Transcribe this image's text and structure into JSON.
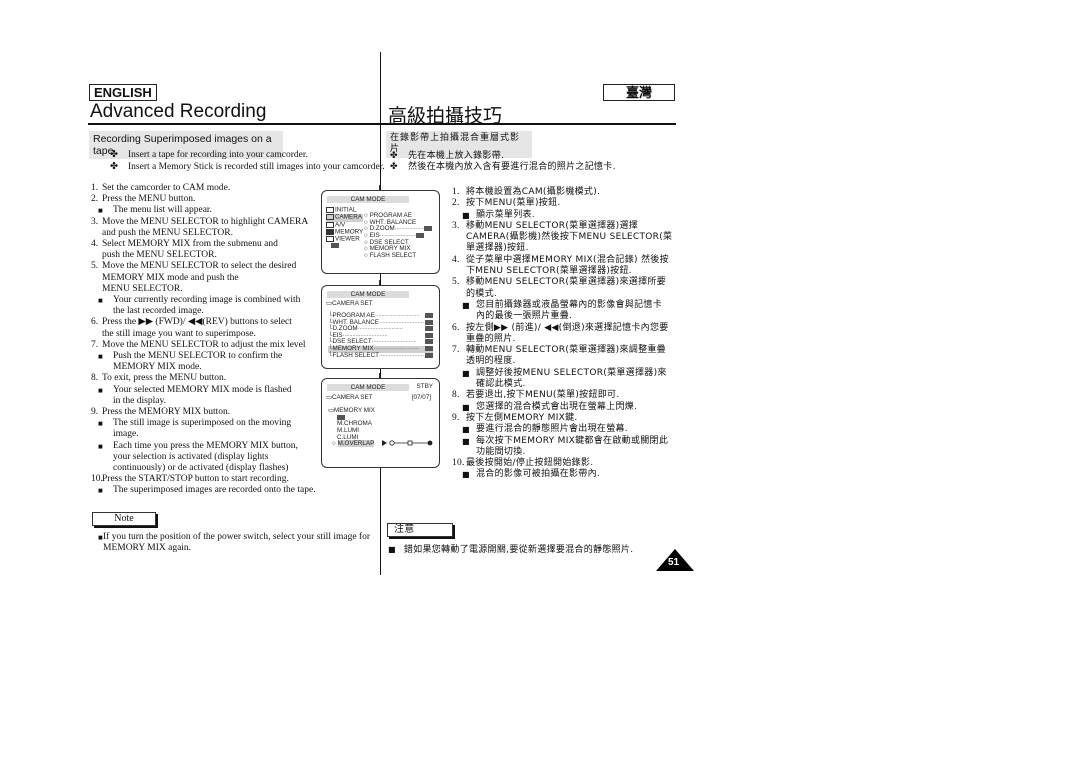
{
  "header": {
    "lang_en": "ENGLISH",
    "lang_zh": "臺灣",
    "title_en": "Advanced Recording",
    "title_zh": "高級拍攝技巧"
  },
  "english": {
    "subhead": "Recording Superimposed images on a tape",
    "intro_bullets": [
      "Insert a tape for recording into your camcorder.",
      "Insert a Memory Stick is recorded still images into your camcorder."
    ],
    "steps": [
      {
        "n": "1.",
        "lines": [
          "Set the camcorder to CAM mode."
        ]
      },
      {
        "n": "2.",
        "lines": [
          "Press the MENU button."
        ],
        "subs": [
          [
            "The menu list will appear."
          ]
        ]
      },
      {
        "n": "3.",
        "lines": [
          "Move the MENU SELECTOR to highlight CAMERA",
          "and push the MENU SELECTOR."
        ]
      },
      {
        "n": "4.",
        "lines": [
          "Select MEMORY MIX from the submenu and",
          "push the MENU SELECTOR."
        ]
      },
      {
        "n": "5.",
        "lines": [
          "Move the MENU SELECTOR to select the desired",
          "MEMORY MIX mode and push the",
          "MENU SELECTOR."
        ],
        "subs": [
          [
            "Your currently recording image is combined with",
            "the last recorded image."
          ]
        ]
      },
      {
        "n": "6.",
        "lines": [
          "Press the ▶▶ (FWD)/ ◀◀(REV) buttons to select",
          "the still image you want to superimpose."
        ]
      },
      {
        "n": "7.",
        "lines": [
          "Move the MENU SELECTOR to adjust the mix level"
        ],
        "subs": [
          [
            "Push the MENU SELECTOR to confirm the",
            "MEMORY MIX mode."
          ]
        ]
      },
      {
        "n": "8.",
        "lines": [
          "To exit, press the MENU button."
        ],
        "subs": [
          [
            "Your selected MEMORY MIX mode is flashed",
            "in the display."
          ]
        ]
      },
      {
        "n": "9.",
        "lines": [
          "Press the MEMORY MIX button."
        ],
        "subs": [
          [
            "The still image is superimposed on the moving",
            "image."
          ],
          [
            "Each time you press the MEMORY MIX button,",
            "your selection is activated (display lights",
            "continuously) or de activated (display flashes)"
          ]
        ]
      },
      {
        "n": "10.",
        "lines": [
          "Press the START/STOP button to start recording."
        ],
        "subs": [
          [
            "The superimposed images are recorded onto the tape."
          ]
        ]
      }
    ],
    "note_label": "Note",
    "note_lines": [
      "If you turn the position of the power switch, select your still image for",
      "MEMORY MIX again."
    ]
  },
  "chinese": {
    "subhead": "在錄影帶上拍攝混合重層式影片",
    "intro_bullets": [
      "先在本機上放入錄影帶.",
      "然後在本機內放入含有要進行混合的照片之記憶卡."
    ],
    "steps": [
      {
        "n": "1.",
        "lines": [
          "將本機設置為CAM(攝影機模式)."
        ]
      },
      {
        "n": "2.",
        "lines": [
          "按下MENU(菜單)按鈕."
        ],
        "subs": [
          [
            "顯示菜單列表."
          ]
        ]
      },
      {
        "n": "3.",
        "lines": [
          "移動MENU SELECTOR(菜單選擇器)選擇",
          "CAMERA(攝影機)然後按下MENU SELECTOR(菜",
          "單選擇器)按鈕."
        ]
      },
      {
        "n": "4.",
        "lines": [
          "從子菜單中選擇MEMORY MIX(混合記錄) 然後按",
          "下MENU SELECTOR(菜單選擇器)按鈕."
        ]
      },
      {
        "n": "5.",
        "lines": [
          "移動MENU SELECTOR(菜單選擇器)來選擇所要",
          "的模式."
        ],
        "subs": [
          [
            "您目前攝錄器或液晶螢幕內的影像會與記憶卡",
            "內的最後一張照片重疊."
          ]
        ]
      },
      {
        "n": "6.",
        "lines": [
          "按左側▶▶ (前進)/ ◀◀(倒退)來選擇記憶卡內您要",
          "重疊的照片."
        ]
      },
      {
        "n": "7.",
        "lines": [
          "轉動MENU SELECTOR(菜單選擇器)來調整重疊",
          "透明的程度."
        ],
        "subs": [
          [
            "調整好後按MENU SELECTOR(菜單選擇器)來",
            "確認此模式."
          ]
        ]
      },
      {
        "n": "8.",
        "lines": [
          "若要退出,按下MENU(菜單)按鈕即可."
        ],
        "subs": [
          [
            "您選擇的混合模式會出現在螢幕上閃爍."
          ]
        ]
      },
      {
        "n": "9.",
        "lines": [
          "按下左側MEMORY MIX鍵."
        ],
        "subs": [
          [
            "要進行混合的靜態照片會出現在螢幕."
          ],
          [
            "每次按下MEMORY MIX鍵都會在啟動或關閉此",
            "功能間切換."
          ]
        ]
      },
      {
        "n": "10.",
        "lines": [
          "最後按開始/停止按鈕開始錄影."
        ],
        "subs": [
          [
            "混合的影像可被拍攝在影帶內."
          ]
        ]
      }
    ],
    "note_label": "注意",
    "note_line": "錯如果您轉動了電源開關,要從新選擇要混合的靜態照片."
  },
  "screens": {
    "screen1": {
      "title": "CAM MODE",
      "menu": [
        "INITIAL",
        "CAMERA",
        "A/V",
        "MEMORY",
        "VIEWER"
      ],
      "sub": [
        "PROGRAM AE",
        "WHT. BALANCE",
        "D.ZOOM",
        "EIS",
        "DSE SELECT",
        "MEMORY MIX",
        "FLASH SELECT"
      ]
    },
    "screen2": {
      "title": "CAM MODE",
      "section": "CAMERA SET",
      "items": [
        "PROGRAM AE",
        "WHT. BALANCE",
        "D.ZOOM",
        "EIS",
        "DSE SELECT",
        "MEMORY MIX",
        "FLASH SELECT"
      ]
    },
    "screen3": {
      "title": "CAM MODE",
      "status": "STBY",
      "section": "CAMERA SET",
      "counter": "[07/07]",
      "submenu": "MEMORY MIX",
      "options": [
        "M.CHROMA",
        "M.LUMI",
        "C.LUMI",
        "M.OVERLAP"
      ],
      "mix_level": 1.0
    }
  },
  "page_number": "51"
}
